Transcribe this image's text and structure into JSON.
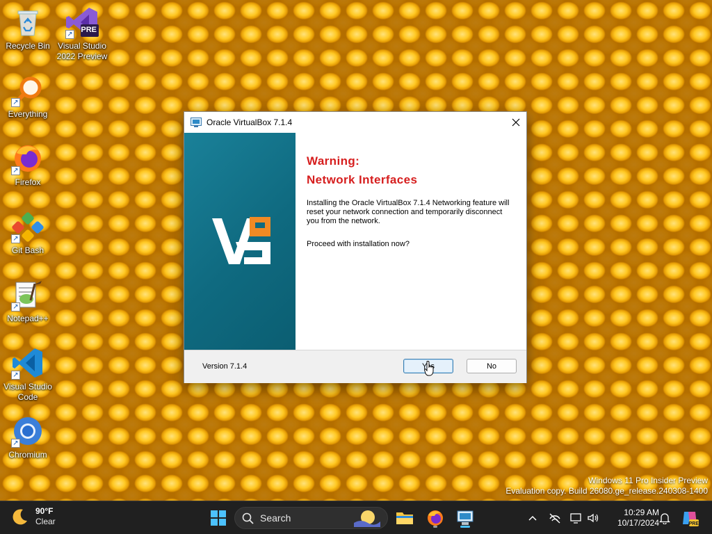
{
  "desktop": {
    "icons": [
      {
        "label": "Recycle Bin",
        "icon": "recycle-bin-icon"
      },
      {
        "label": "Visual Studio 2022 Preview",
        "badge": "PRE",
        "icon": "visual-studio-icon"
      },
      {
        "label": "Everything",
        "icon": "everything-search-icon"
      },
      {
        "label": "Firefox",
        "icon": "firefox-icon"
      },
      {
        "label": "Git Bash",
        "icon": "git-bash-icon"
      },
      {
        "label": "Notepad++",
        "icon": "notepad-plus-plus-icon"
      },
      {
        "label": "Visual Studio Code",
        "icon": "vscode-icon"
      },
      {
        "label": "Chromium",
        "icon": "chromium-icon"
      }
    ],
    "watermark": {
      "line1": "Windows 11 Pro Insider Preview",
      "line2": "Evaluation copy. Build 26080.ge_release.240308-1400"
    }
  },
  "dialog": {
    "title": "Oracle VirtualBox 7.1.4",
    "heading_line1": "Warning:",
    "heading_line2": "Network Interfaces",
    "message": "Installing the Oracle VirtualBox 7.1.4 Networking feature will reset your network connection and temporarily disconnect you from the network.",
    "question": "Proceed with installation now?",
    "version_label": "Version 7.1.4",
    "yes_label": "Yes",
    "no_label": "No",
    "colors": {
      "heading": "#d61e1e",
      "banner": "#137387"
    }
  },
  "taskbar": {
    "weather": {
      "temp": "90°F",
      "condition": "Clear",
      "icon": "moon-icon"
    },
    "search_label": "Search",
    "pinned": [
      "start-icon",
      "file-explorer-icon",
      "firefox-icon",
      "virtualbox-installer-icon"
    ],
    "tray": [
      "chevron-up-icon",
      "network-off-icon",
      "display-icon",
      "speaker-icon"
    ],
    "clock": {
      "time": "10:29 AM",
      "date": "10/17/2024"
    },
    "notification_icon": "bell-icon",
    "copilot_badge": "PRE"
  }
}
